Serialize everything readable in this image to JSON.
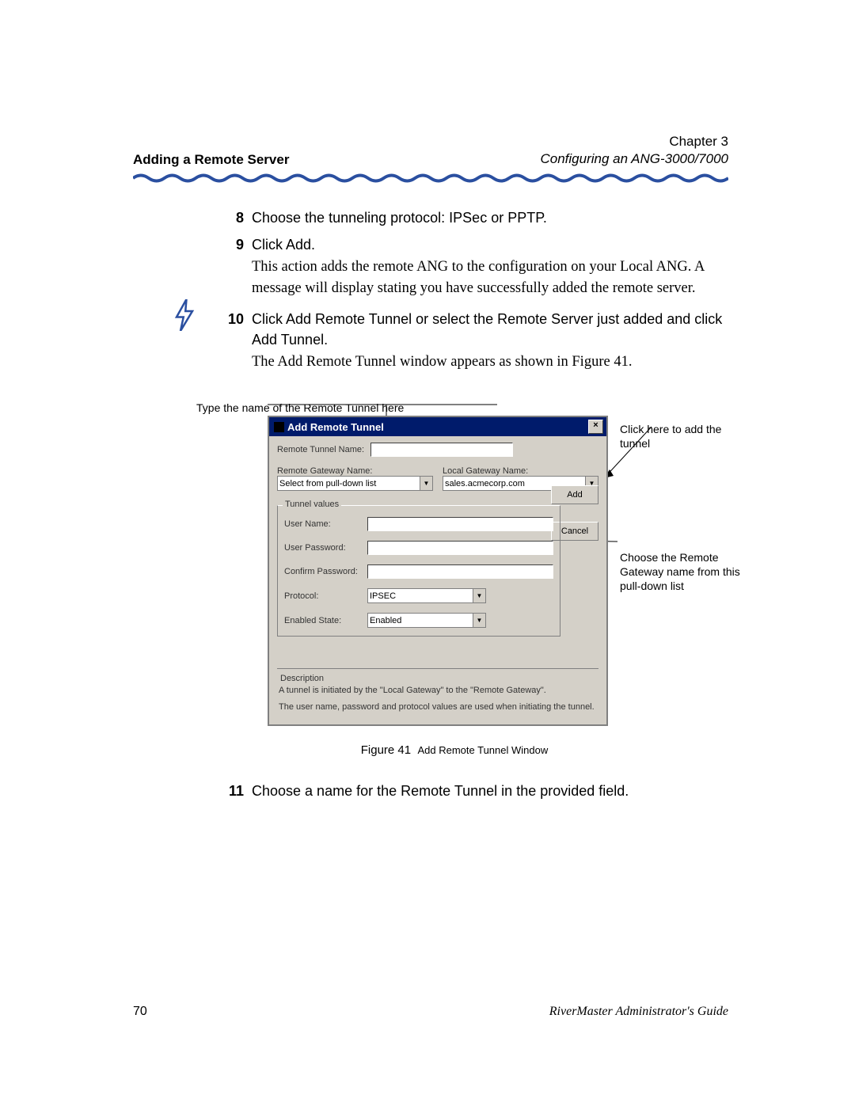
{
  "header": {
    "section_title": "Adding a Remote Server",
    "chapter": "Chapter 3",
    "subtitle": "Configuring an ANG-3000/7000"
  },
  "steps": {
    "s8": {
      "num": "8",
      "text": "Choose the tunneling protocol: IPSec or PPTP."
    },
    "s9": {
      "num": "9",
      "text": "Click Add.",
      "follow": "This action adds the remote ANG to the configuration on your Local ANG. A message will display stating you have successfully added the remote server."
    },
    "s10": {
      "num": "10",
      "text": "Click Add Remote Tunnel or select the Remote Server just added and click Add Tunnel.",
      "follow": "The Add Remote Tunnel window appears as shown in Figure 41."
    },
    "s11": {
      "num": "11",
      "text": "Choose a name for the Remote Tunnel in the provided field."
    }
  },
  "annotations": {
    "top": "Type the name of the Remote Tunnel here",
    "right_top": "Click here to add the tunnel",
    "right_mid": "Choose the Remote Gateway name from this pull-down list"
  },
  "dialog": {
    "title": "Add Remote Tunnel",
    "close_glyph": "×",
    "labels": {
      "remote_tunnel_name": "Remote Tunnel Name:",
      "remote_gateway_name": "Remote Gateway Name:",
      "local_gateway_name": "Local Gateway Name:",
      "tunnel_values": "Tunnel values",
      "user_name": "User Name:",
      "user_password": "User Password:",
      "confirm_password": "Confirm Password:",
      "protocol": "Protocol:",
      "enabled_state": "Enabled State:",
      "description": "Description"
    },
    "values": {
      "remote_gateway_sel": "Select from pull-down list",
      "local_gateway_sel": "sales.acmecorp.com",
      "protocol_sel": "IPSEC",
      "enabled_sel": "Enabled"
    },
    "buttons": {
      "add": "Add",
      "cancel": "Cancel"
    },
    "description_text1": "A tunnel is initiated by the \"Local Gateway\" to the \"Remote Gateway\".",
    "description_text2": "The user name, password and protocol values are used when initiating the tunnel."
  },
  "figure": {
    "label": "Figure 41",
    "caption": "Add Remote Tunnel Window"
  },
  "footer": {
    "page": "70",
    "guide": "RiverMaster Administrator's Guide"
  }
}
